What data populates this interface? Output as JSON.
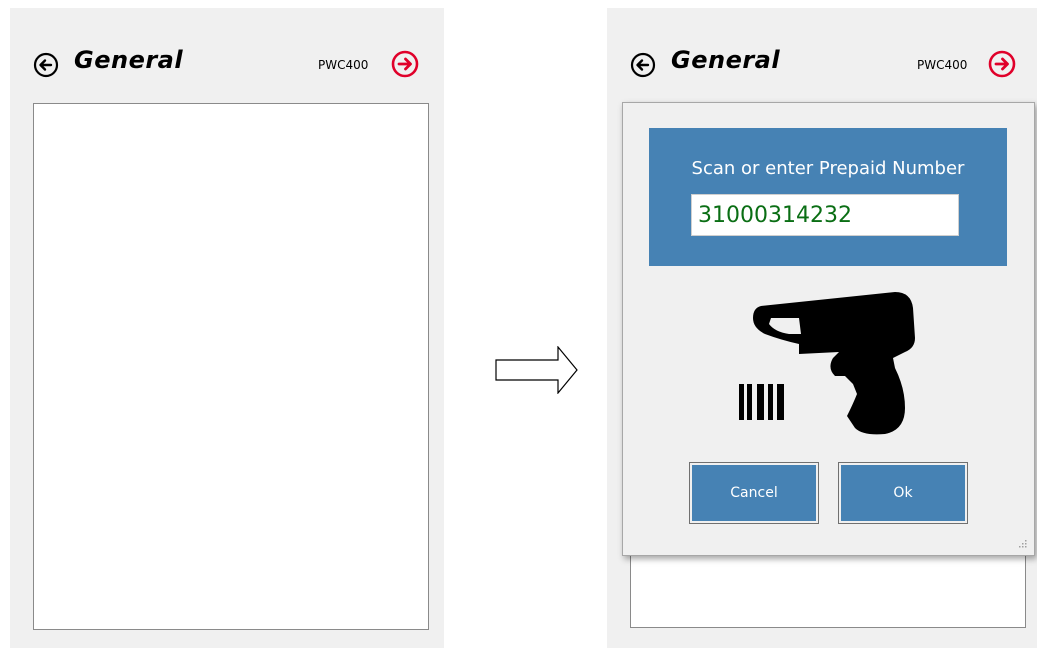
{
  "left_screen": {
    "title": "General",
    "device": "PWC400"
  },
  "right_screen": {
    "title": "General",
    "device": "PWC400"
  },
  "dialog": {
    "prompt": "Scan or enter Prepaid Number",
    "prepaid_value": "31000314232",
    "cancel_label": "Cancel",
    "ok_label": "Ok"
  },
  "icons": {
    "back": "back-arrow-circle-icon",
    "next": "next-arrow-circle-icon",
    "transition": "right-arrow-icon",
    "scanner": "barcode-scanner-icon"
  },
  "colors": {
    "accent_blue": "#4682b4",
    "next_red": "#e0002a",
    "value_green": "#0a6e14",
    "panel_gray": "#f0f0f0"
  }
}
